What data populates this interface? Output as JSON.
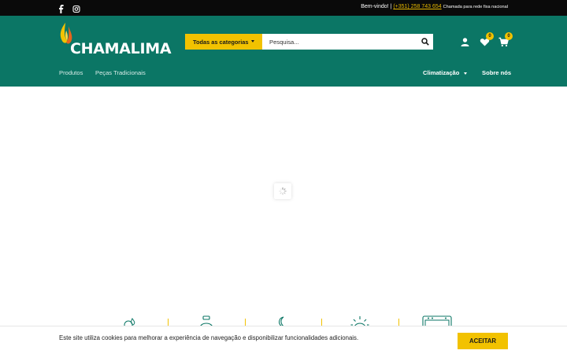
{
  "topbar": {
    "welcome": "Bem-vindo! |",
    "phone": "(+351) 258 743 654",
    "phone_note": "Chamada para rede fixa nacional",
    "social_icons": [
      "facebook-icon",
      "instagram-icon"
    ]
  },
  "brand": {
    "name": "CHAMALIMA",
    "colors": {
      "header": "#0b7665",
      "accent": "#f2c200",
      "topbar": "#0a0a0a"
    }
  },
  "search": {
    "category_label": "Todas as categorias",
    "placeholder": "Pesquisa..."
  },
  "header_icons": {
    "wishlist_count": "0",
    "cart_count": "0"
  },
  "nav": {
    "left": [
      "Produtos",
      "Peças Tradicionais"
    ],
    "climatizacao": "Climatização",
    "sobre": "Sobre nós"
  },
  "features": {
    "icons": [
      "gas-energy-icon",
      "gas-cylinder-icon",
      "moon-icon",
      "sun-icon",
      "oven-icon"
    ]
  },
  "cookie": {
    "message": "Este site utiliza cookies para melhorar a experiência de navegação e disponibilizar funcionalidades adicionais.",
    "accept_label": "ACEITAR"
  }
}
